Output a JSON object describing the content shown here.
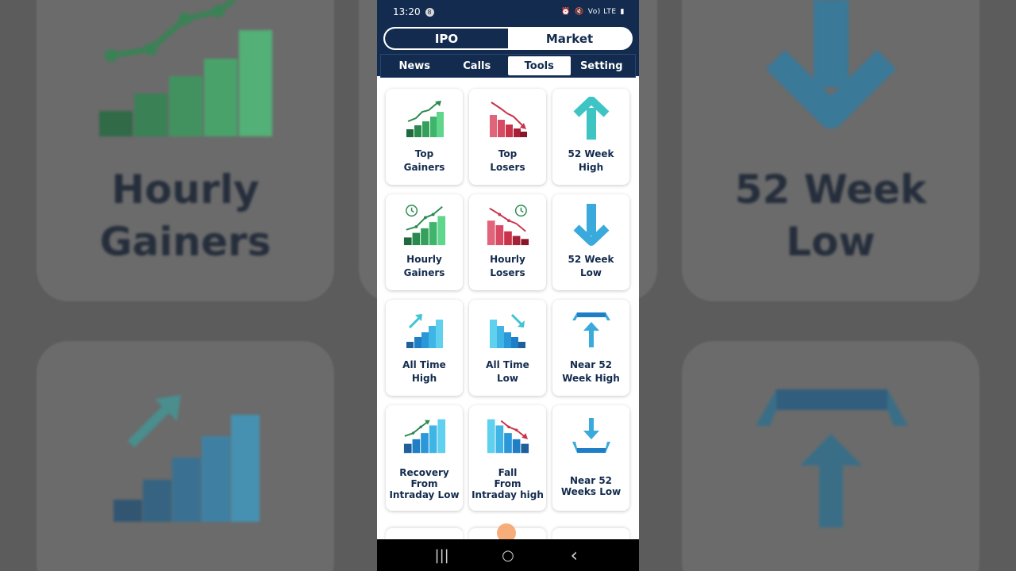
{
  "status": {
    "time": "13:20",
    "notification_badge": "8",
    "right_indicators": "Vo) LTE",
    "battery": "▮"
  },
  "segments": [
    {
      "label": "IPO",
      "active": true
    },
    {
      "label": "Market",
      "active": false
    }
  ],
  "tabs": [
    {
      "label": "News",
      "active": false
    },
    {
      "label": "Calls",
      "active": false
    },
    {
      "label": "Tools",
      "active": true
    },
    {
      "label": "Setting",
      "active": false
    }
  ],
  "tools": [
    {
      "label": "Top\nGainers",
      "icon": "top-gainers-icon"
    },
    {
      "label": "Top\nLosers",
      "icon": "top-losers-icon"
    },
    {
      "label": "52 Week\nHigh",
      "icon": "arrow-up-icon"
    },
    {
      "label": "Hourly\nGainers",
      "icon": "hourly-gainers-icon"
    },
    {
      "label": "Hourly\nLosers",
      "icon": "hourly-losers-icon"
    },
    {
      "label": "52 Week\nLow",
      "icon": "arrow-down-icon"
    },
    {
      "label": "All Time\nHigh",
      "icon": "all-time-high-icon"
    },
    {
      "label": "All Time\nLow",
      "icon": "all-time-low-icon"
    },
    {
      "label": "Near 52\nWeek High",
      "icon": "near-52-week-high-icon"
    },
    {
      "label": "Recovery\nFrom\nIntraday Low",
      "icon": "recovery-icon"
    },
    {
      "label": "Fall\nFrom\nIntraday high",
      "icon": "fall-icon"
    },
    {
      "label": "Near 52\nWeeks Low",
      "icon": "near-52-weeks-low-icon"
    }
  ],
  "background": {
    "left_text": "Hourly\nGainers",
    "right_text": "52 Week\nLow"
  },
  "navbar": {
    "recents": "|||",
    "home": "○",
    "back": "‹"
  },
  "colors": {
    "navy": "#132b4e",
    "green": "#2db36a",
    "red": "#c8334a",
    "cyan": "#3fc4d6",
    "blue": "#1e7fc6"
  }
}
